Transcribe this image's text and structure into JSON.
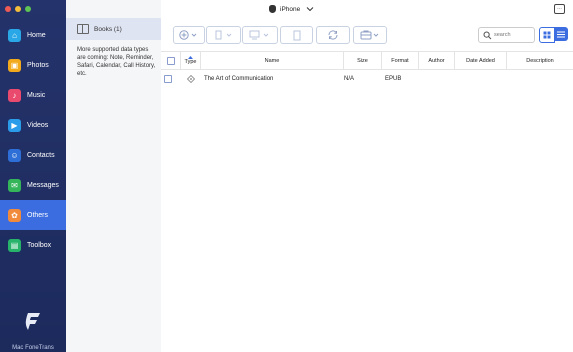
{
  "window": {
    "device_name": "iPhone",
    "message_icon": "message-icon"
  },
  "sidebar": {
    "items": [
      {
        "label": "Home",
        "icon": "home-icon",
        "color": "#2aa7e6"
      },
      {
        "label": "Photos",
        "icon": "photos-icon",
        "color": "#f2a91c"
      },
      {
        "label": "Music",
        "icon": "music-icon",
        "color": "#ea4a6e"
      },
      {
        "label": "Videos",
        "icon": "videos-icon",
        "color": "#2a9cea"
      },
      {
        "label": "Contacts",
        "icon": "contacts-icon",
        "color": "#2d6fd6"
      },
      {
        "label": "Messages",
        "icon": "messages-icon",
        "color": "#34b55a"
      },
      {
        "label": "Others",
        "icon": "others-icon",
        "color": "#f28a3c"
      },
      {
        "label": "Toolbox",
        "icon": "toolbox-icon",
        "color": "#27b36a"
      }
    ],
    "active_index": 6,
    "brand": "Mac FoneTrans"
  },
  "categories": {
    "selected": "Books (1)",
    "note": "More supported data types are coming: Note, Reminder, Safari, Calendar, Call History, etc."
  },
  "toolbar": {
    "search_placeholder": "search",
    "buttons": [
      "add-icon",
      "export-to-pc-icon",
      "export-to-device-icon",
      "delete-icon",
      "refresh-icon",
      "toolbox-icon"
    ]
  },
  "table": {
    "columns": [
      "Type",
      "Name",
      "Size",
      "Format",
      "Author",
      "Date Added",
      "Description"
    ],
    "rows": [
      {
        "name": "The Art of Communication",
        "size": "N/A",
        "format": "EPUB",
        "author": "",
        "date_added": "",
        "description": ""
      }
    ]
  },
  "colors": {
    "sidebar_bg": "#24336b",
    "accent": "#3b6de0",
    "category_bg": "#f5f6f8",
    "selected_bg": "#dfe4f2"
  }
}
